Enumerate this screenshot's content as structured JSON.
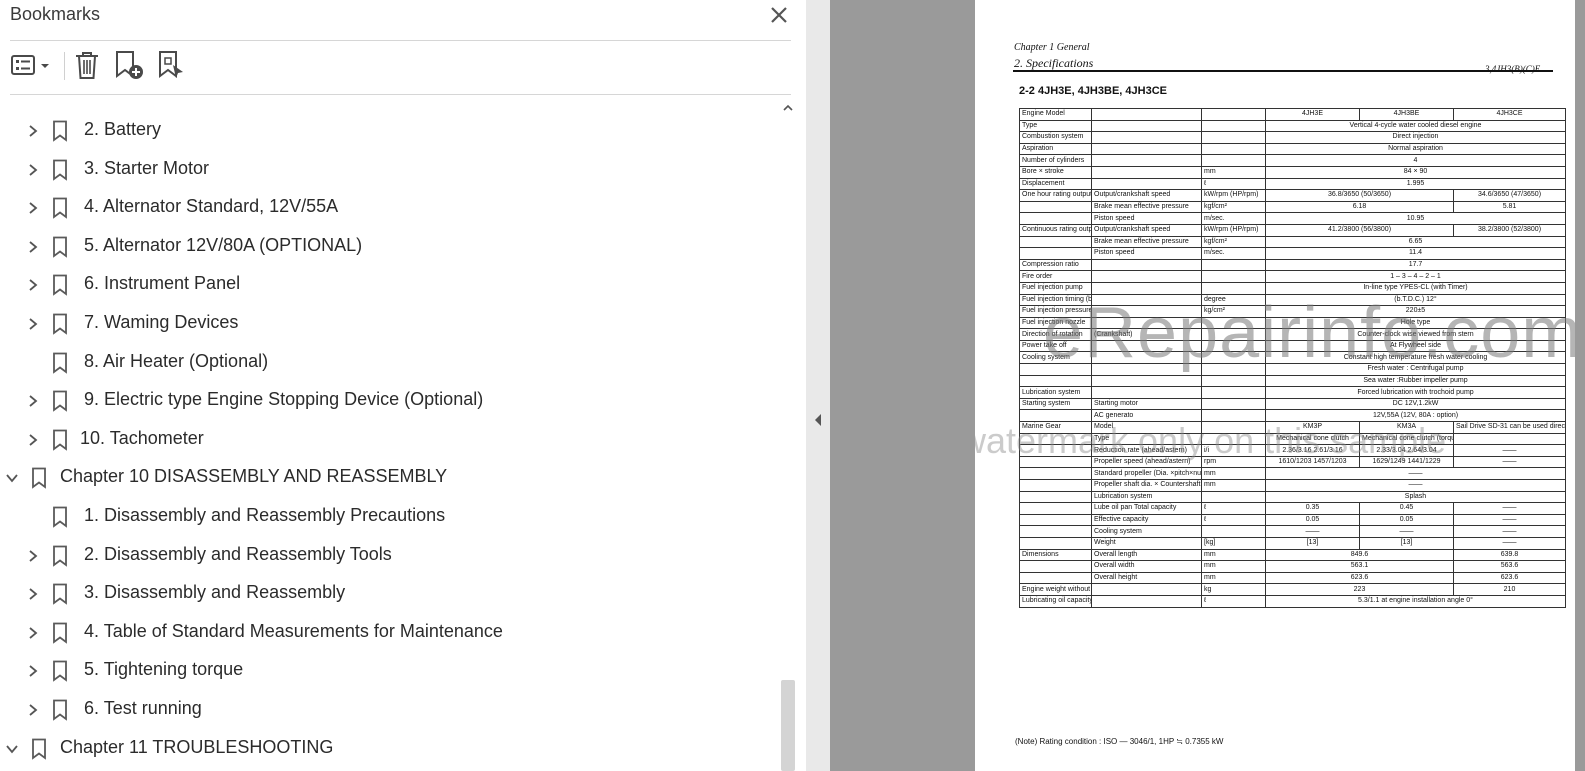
{
  "panel": {
    "title": "Bookmarks",
    "toolbar": [
      "options-menu",
      "delete-bookmark",
      "new-bookmark",
      "bookmark-from-selection"
    ]
  },
  "bookmarks": [
    {
      "label": "2. Battery",
      "expandable": true,
      "level": 1
    },
    {
      "label": "3. Starter Motor",
      "expandable": true,
      "level": 1
    },
    {
      "label": "4. Alternator Standard, 12V/55A",
      "expandable": true,
      "level": 1
    },
    {
      "label": "5. Alternator 12V/80A (OPTIONAL)",
      "expandable": true,
      "level": 1
    },
    {
      "label": "6. Instrument Panel",
      "expandable": true,
      "level": 1
    },
    {
      "label": "7. Waming Devices",
      "expandable": true,
      "level": 1
    },
    {
      "label": "8. Air Heater (Optional)",
      "expandable": false,
      "level": 1
    },
    {
      "label": "9. Electric type Engine Stopping Device (Optional)",
      "expandable": true,
      "level": 1
    },
    {
      "label": "10. Tachometer",
      "expandable": true,
      "level": 1
    },
    {
      "label": "Chapter 10 DISASSEMBLY AND REASSEMBLY",
      "expandable": true,
      "expanded": true,
      "level": 0
    },
    {
      "label": "1. Disassembly and Reassembly Precautions",
      "expandable": false,
      "level": 1
    },
    {
      "label": "2. Disassembly and Reassembly Tools",
      "expandable": true,
      "level": 1
    },
    {
      "label": "3. Disassembly and Reassembly",
      "expandable": true,
      "level": 1
    },
    {
      "label": "4. Table of Standard Measurements for Maintenance",
      "expandable": true,
      "level": 1
    },
    {
      "label": "5. Tightening torque",
      "expandable": true,
      "level": 1
    },
    {
      "label": "6. Test running",
      "expandable": true,
      "level": 1
    },
    {
      "label": "Chapter 11 TROUBLESHOOTING",
      "expandable": true,
      "expanded": true,
      "level": 0
    }
  ],
  "document": {
    "chapter": "Chapter 1 General",
    "section": "2. Specifications",
    "model_ref": "3,4JH3(B)(C)E",
    "heading": "2-2  4JH3E, 4JH3BE, 4JH3CE",
    "table": [
      [
        "Engine Model",
        "",
        "",
        "4JH3E",
        "4JH3BE",
        "4JH3CE"
      ],
      [
        "Type",
        "",
        "",
        "Vertical 4-cycle water cooled diesel engine",
        "",
        ""
      ],
      [
        "Combustion system",
        "",
        "",
        "Direct injection",
        "",
        ""
      ],
      [
        "Aspiration",
        "",
        "",
        "Normal aspiration",
        "",
        ""
      ],
      [
        "Number of cylinders",
        "",
        "",
        "4",
        "",
        ""
      ],
      [
        "Bore × stroke",
        "",
        "mm",
        "84 × 90",
        "",
        ""
      ],
      [
        "Displacement",
        "",
        "ℓ",
        "1.995",
        "",
        ""
      ],
      [
        "One hour rating output (flywheel output)",
        "Output/crankshaft speed",
        "kW/rpm (HP/rpm)",
        "36.8/3650 (50/3650)",
        "",
        "34.6/3650 (47/3650)"
      ],
      [
        "",
        "Brake mean effective pressure",
        "kgf/cm²",
        "6.18",
        "",
        "5.81"
      ],
      [
        "",
        "Piston speed",
        "m/sec.",
        "10.95",
        "",
        ""
      ],
      [
        "Continuous rating output (DIN6270A) flywheel output",
        "Output/crankshaft speed",
        "kW/rpm (HP/rpm)",
        "41.2/3800 (56/3800)",
        "",
        "38.2/3800 (52/3800)"
      ],
      [
        "",
        "Brake mean effective pressure",
        "kgf/cm²",
        "6.65",
        "",
        ""
      ],
      [
        "",
        "Piston speed",
        "m/sec.",
        "11.4",
        "",
        ""
      ],
      [
        "Compression ratio",
        "",
        "",
        "17.7",
        "",
        ""
      ],
      [
        "Fire order",
        "",
        "",
        "1 – 3 – 4 – 2 – 1",
        "",
        ""
      ],
      [
        "Fuel injection pump",
        "",
        "",
        "In-line type YPES-CL (with Timer)",
        "",
        ""
      ],
      [
        "Fuel injection timing (b.T.D.C.)",
        "",
        "degree",
        "(b.T.D.C.) 12°",
        "",
        ""
      ],
      [
        "Fuel injection pressure",
        "",
        "kg/cm²",
        "220±5",
        "",
        ""
      ],
      [
        "Fuel injection nozzle",
        "",
        "",
        "Hole type",
        "",
        ""
      ],
      [
        "Direction of rotation",
        "(Crankshaft)",
        "",
        "Counter-clock wise viewed from stern",
        "",
        ""
      ],
      [
        "Power take off",
        "",
        "",
        "At Flywheel side",
        "",
        ""
      ],
      [
        "Cooling system",
        "",
        "",
        "Constant high temperature fresh water cooling",
        "",
        ""
      ],
      [
        "",
        "",
        "",
        "Fresh water : Centrifugal pump",
        "",
        ""
      ],
      [
        "",
        "",
        "",
        "Sea water :Rubber impeller pump",
        "",
        ""
      ],
      [
        "Lubrication system",
        "",
        "",
        "Forced lubrication with trochoid pump",
        "",
        ""
      ],
      [
        "Starting system",
        "Starting motor",
        "",
        "DC 12V,1.2kW",
        "",
        ""
      ],
      [
        "",
        "AC generato",
        "",
        "12V,55A (12V, 80A : option)",
        "",
        ""
      ],
      [
        "Marine Gear",
        "Model",
        "",
        "KM3P",
        "KM3A",
        "Sail Drive SD-31 can be used directly on location."
      ],
      [
        "",
        "Type",
        "",
        "Mechanical cone clutch",
        "Mechanical cone clutch (torque limiter no angle)",
        ""
      ],
      [
        "",
        "Reduction rate (ahead/astern)",
        "i/i",
        "2.36/3.16  2.61/3.16",
        "2.33/3.04  2.64/3.04",
        "——"
      ],
      [
        "",
        "Propeller speed (ahead/astern)",
        "rpm",
        "1610/1203  1457/1203",
        "1629/1249  1441/1229",
        "——"
      ],
      [
        "",
        "Standard propeller (Dia. ×pitch×number)",
        "mm",
        "——",
        "",
        ""
      ],
      [
        "",
        "Propeller shaft dia. × Countershaft dia.",
        "mm",
        "——",
        "",
        ""
      ],
      [
        "",
        "Lubrication system",
        "",
        "Splash",
        "",
        ""
      ],
      [
        "",
        "Lube oil pan  Total capacity",
        "ℓ",
        "0.35",
        "0.45",
        "——"
      ],
      [
        "",
        "Effective capacity",
        "ℓ",
        "0.05",
        "0.05",
        "——"
      ],
      [
        "",
        "Cooling system",
        "",
        "——",
        "——",
        "——"
      ],
      [
        "",
        "Weight",
        "[kg]",
        "[13]",
        "[13]",
        "——"
      ],
      [
        "Dimensions",
        "Overall length",
        "mm",
        "849.6",
        "",
        "639.8"
      ],
      [
        "",
        "Overall width",
        "mm",
        "563.1",
        "",
        "563.6"
      ],
      [
        "",
        "Overall height",
        "mm",
        "623.6",
        "",
        "623.6"
      ],
      [
        "Engine weight without marine gear (dry)",
        "",
        "kg",
        "223",
        "",
        "210"
      ],
      [
        "Lubricating oil capacity Effect/max.",
        "",
        "ℓ",
        "5.3/1.1  at engine installation angle 0°",
        "",
        ""
      ]
    ],
    "note": "(Note)  Rating condition :  ISO — 3046/1,  1HP ≒ 0.7355 kW",
    "watermark_main": "eRepairinfo.com",
    "watermark_sub": "watermark only on this sample"
  }
}
